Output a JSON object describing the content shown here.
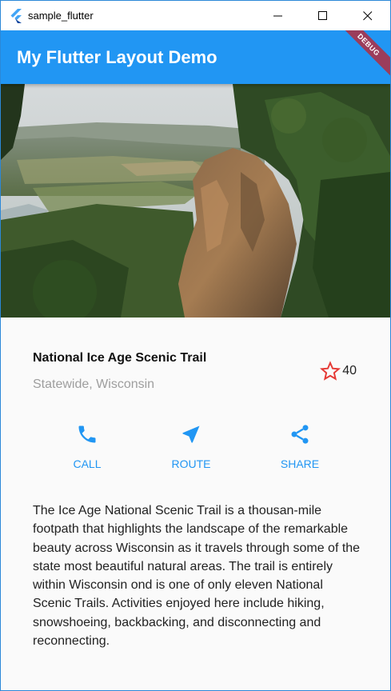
{
  "window": {
    "title": "sample_flutter",
    "icon": "flutter-logo-icon",
    "controls": [
      "minimize-icon",
      "maximize-icon",
      "close-icon"
    ]
  },
  "appbar": {
    "title": "My Flutter Layout Demo",
    "debug_banner": "DEBUG",
    "color": "#2196f3"
  },
  "hero": {
    "description_icon": "lake-photo"
  },
  "trail": {
    "name": "National Ice Age Scenic Trail",
    "location": "Statewide, Wisconsin",
    "rating_icon": "star-outline-icon",
    "rating_count": "40",
    "star_color": "#e53935"
  },
  "actions": [
    {
      "icon": "call-icon",
      "label": "CALL"
    },
    {
      "icon": "route-icon",
      "label": "ROUTE"
    },
    {
      "icon": "share-icon",
      "label": "SHARE"
    }
  ],
  "description": "The Ice Age National Scenic Trail is a thousan-mile footpath that highlights the landscape of the remarkable beauty across Wisconsin as it travels through some of the state most beautiful natural areas. The trail is entirely within Wisconsin ond is one of only eleven National Scenic Trails. Activities enjoyed here include hiking, snowshoeing, backbacking, and disconnecting and reconnecting."
}
